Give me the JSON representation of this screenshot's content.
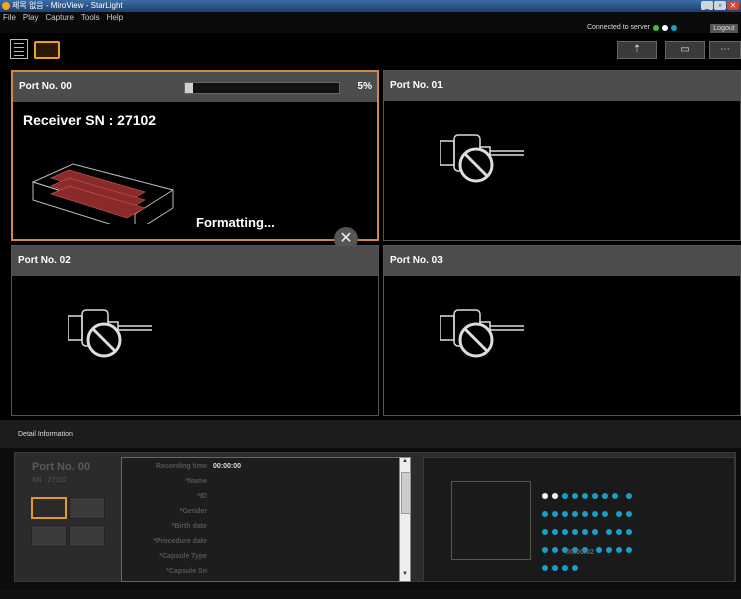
{
  "window": {
    "title": "제목 없음 - MiroView - StarLight",
    "min": "_",
    "max": "▫",
    "close": "✕"
  },
  "menu": [
    "File",
    "Play",
    "Capture",
    "Tools",
    "Help"
  ],
  "server": {
    "label": "Connected to server",
    "dots": [
      "#3fbf3f",
      "#ffffff",
      "#1a9ec8"
    ]
  },
  "logout": "Logout",
  "ports": [
    {
      "title": "Port No. 00",
      "progress_pct": 5,
      "progress_label": "5%",
      "receiver": "Receiver SN : 27102",
      "status": "Formatting...",
      "cancel": "✕"
    },
    {
      "title": "Port No. 01"
    },
    {
      "title": "Port No. 02"
    },
    {
      "title": "Port No. 03"
    }
  ],
  "detail": {
    "header": "Detail Information",
    "port": "Port No. 00",
    "sn": "SN : 27102",
    "fields": [
      {
        "label": "Recording time",
        "value": "00:00:00"
      },
      {
        "label": "*Name",
        "value": ""
      },
      {
        "label": "*ID",
        "value": ""
      },
      {
        "label": "*Gender",
        "value": ""
      },
      {
        "label": "*Birth date",
        "value": ""
      },
      {
        "label": "*Procedure date",
        "value": ""
      },
      {
        "label": "*Capsule Type",
        "value": ""
      },
      {
        "label": "*Capsule Sn",
        "value": ""
      }
    ],
    "time": "00:00:02"
  }
}
